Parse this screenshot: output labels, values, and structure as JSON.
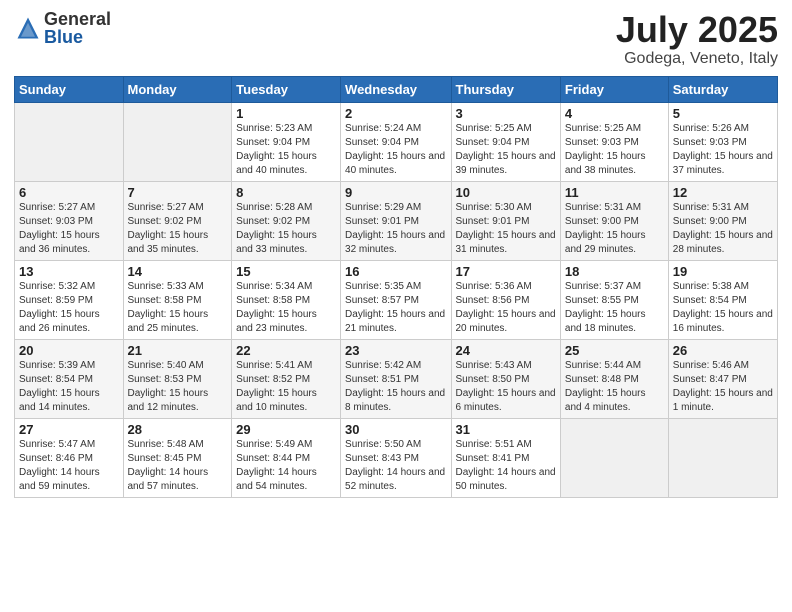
{
  "header": {
    "logo_general": "General",
    "logo_blue": "Blue",
    "month_title": "July 2025",
    "location": "Godega, Veneto, Italy"
  },
  "weekdays": [
    "Sunday",
    "Monday",
    "Tuesday",
    "Wednesday",
    "Thursday",
    "Friday",
    "Saturday"
  ],
  "weeks": [
    [
      {
        "day": "",
        "info": ""
      },
      {
        "day": "",
        "info": ""
      },
      {
        "day": "1",
        "info": "Sunrise: 5:23 AM\nSunset: 9:04 PM\nDaylight: 15 hours and 40 minutes."
      },
      {
        "day": "2",
        "info": "Sunrise: 5:24 AM\nSunset: 9:04 PM\nDaylight: 15 hours and 40 minutes."
      },
      {
        "day": "3",
        "info": "Sunrise: 5:25 AM\nSunset: 9:04 PM\nDaylight: 15 hours and 39 minutes."
      },
      {
        "day": "4",
        "info": "Sunrise: 5:25 AM\nSunset: 9:03 PM\nDaylight: 15 hours and 38 minutes."
      },
      {
        "day": "5",
        "info": "Sunrise: 5:26 AM\nSunset: 9:03 PM\nDaylight: 15 hours and 37 minutes."
      }
    ],
    [
      {
        "day": "6",
        "info": "Sunrise: 5:27 AM\nSunset: 9:03 PM\nDaylight: 15 hours and 36 minutes."
      },
      {
        "day": "7",
        "info": "Sunrise: 5:27 AM\nSunset: 9:02 PM\nDaylight: 15 hours and 35 minutes."
      },
      {
        "day": "8",
        "info": "Sunrise: 5:28 AM\nSunset: 9:02 PM\nDaylight: 15 hours and 33 minutes."
      },
      {
        "day": "9",
        "info": "Sunrise: 5:29 AM\nSunset: 9:01 PM\nDaylight: 15 hours and 32 minutes."
      },
      {
        "day": "10",
        "info": "Sunrise: 5:30 AM\nSunset: 9:01 PM\nDaylight: 15 hours and 31 minutes."
      },
      {
        "day": "11",
        "info": "Sunrise: 5:31 AM\nSunset: 9:00 PM\nDaylight: 15 hours and 29 minutes."
      },
      {
        "day": "12",
        "info": "Sunrise: 5:31 AM\nSunset: 9:00 PM\nDaylight: 15 hours and 28 minutes."
      }
    ],
    [
      {
        "day": "13",
        "info": "Sunrise: 5:32 AM\nSunset: 8:59 PM\nDaylight: 15 hours and 26 minutes."
      },
      {
        "day": "14",
        "info": "Sunrise: 5:33 AM\nSunset: 8:58 PM\nDaylight: 15 hours and 25 minutes."
      },
      {
        "day": "15",
        "info": "Sunrise: 5:34 AM\nSunset: 8:58 PM\nDaylight: 15 hours and 23 minutes."
      },
      {
        "day": "16",
        "info": "Sunrise: 5:35 AM\nSunset: 8:57 PM\nDaylight: 15 hours and 21 minutes."
      },
      {
        "day": "17",
        "info": "Sunrise: 5:36 AM\nSunset: 8:56 PM\nDaylight: 15 hours and 20 minutes."
      },
      {
        "day": "18",
        "info": "Sunrise: 5:37 AM\nSunset: 8:55 PM\nDaylight: 15 hours and 18 minutes."
      },
      {
        "day": "19",
        "info": "Sunrise: 5:38 AM\nSunset: 8:54 PM\nDaylight: 15 hours and 16 minutes."
      }
    ],
    [
      {
        "day": "20",
        "info": "Sunrise: 5:39 AM\nSunset: 8:54 PM\nDaylight: 15 hours and 14 minutes."
      },
      {
        "day": "21",
        "info": "Sunrise: 5:40 AM\nSunset: 8:53 PM\nDaylight: 15 hours and 12 minutes."
      },
      {
        "day": "22",
        "info": "Sunrise: 5:41 AM\nSunset: 8:52 PM\nDaylight: 15 hours and 10 minutes."
      },
      {
        "day": "23",
        "info": "Sunrise: 5:42 AM\nSunset: 8:51 PM\nDaylight: 15 hours and 8 minutes."
      },
      {
        "day": "24",
        "info": "Sunrise: 5:43 AM\nSunset: 8:50 PM\nDaylight: 15 hours and 6 minutes."
      },
      {
        "day": "25",
        "info": "Sunrise: 5:44 AM\nSunset: 8:48 PM\nDaylight: 15 hours and 4 minutes."
      },
      {
        "day": "26",
        "info": "Sunrise: 5:46 AM\nSunset: 8:47 PM\nDaylight: 15 hours and 1 minute."
      }
    ],
    [
      {
        "day": "27",
        "info": "Sunrise: 5:47 AM\nSunset: 8:46 PM\nDaylight: 14 hours and 59 minutes."
      },
      {
        "day": "28",
        "info": "Sunrise: 5:48 AM\nSunset: 8:45 PM\nDaylight: 14 hours and 57 minutes."
      },
      {
        "day": "29",
        "info": "Sunrise: 5:49 AM\nSunset: 8:44 PM\nDaylight: 14 hours and 54 minutes."
      },
      {
        "day": "30",
        "info": "Sunrise: 5:50 AM\nSunset: 8:43 PM\nDaylight: 14 hours and 52 minutes."
      },
      {
        "day": "31",
        "info": "Sunrise: 5:51 AM\nSunset: 8:41 PM\nDaylight: 14 hours and 50 minutes."
      },
      {
        "day": "",
        "info": ""
      },
      {
        "day": "",
        "info": ""
      }
    ]
  ]
}
